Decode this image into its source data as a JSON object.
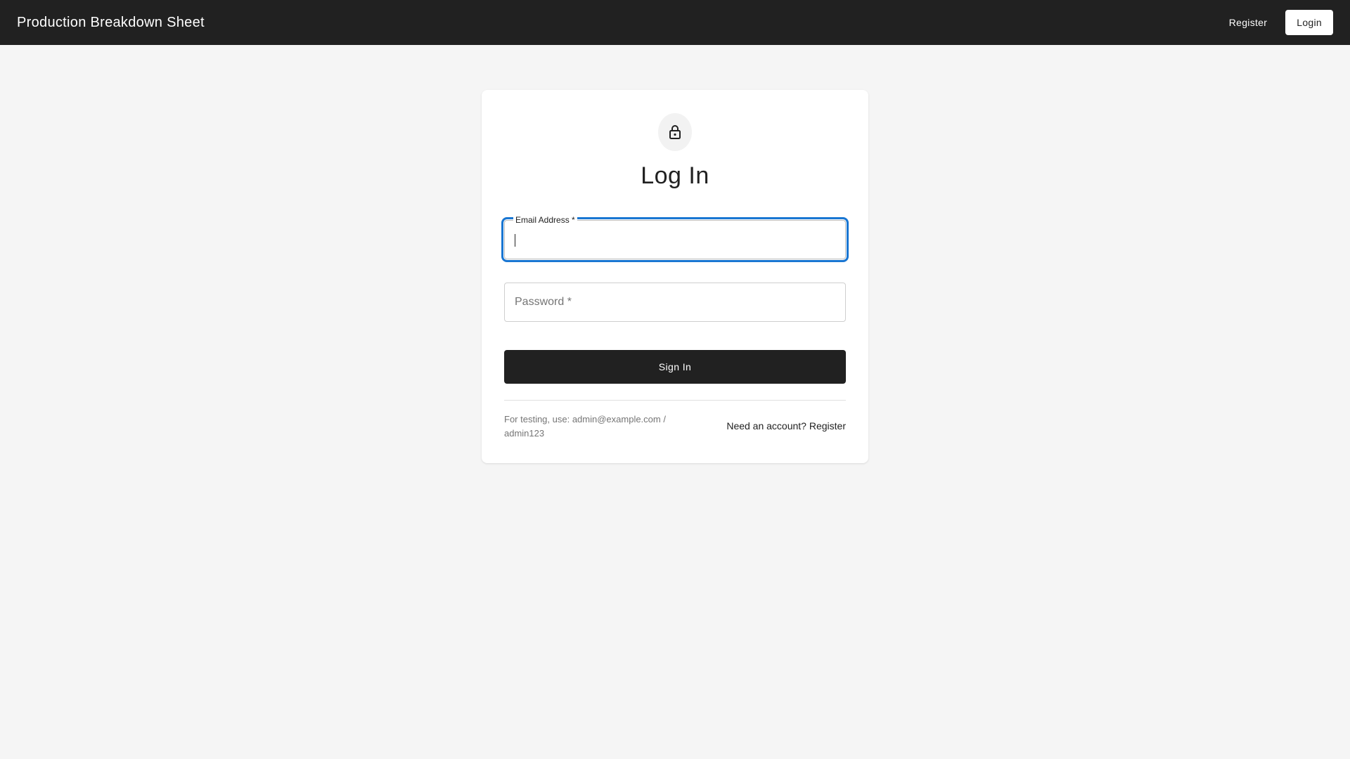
{
  "header": {
    "title": "Production Breakdown Sheet",
    "register_label": "Register",
    "login_label": "Login"
  },
  "login": {
    "icon": "lock-icon",
    "heading": "Log In",
    "email": {
      "label": "Email Address *",
      "value": ""
    },
    "password": {
      "label": "Password *",
      "value": ""
    },
    "submit_label": "Sign In",
    "test_note": "For testing, use: admin@example.com / admin123",
    "register_link": "Need an account? Register"
  },
  "colors": {
    "appbar": "#212121",
    "focus_outline": "#1976d2",
    "background": "#f5f5f5"
  }
}
